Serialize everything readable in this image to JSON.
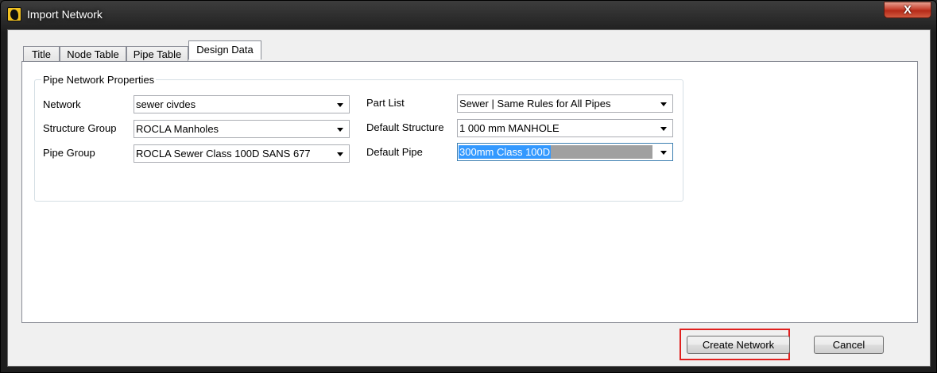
{
  "window": {
    "title": "Import Network",
    "close_glyph": "X"
  },
  "tabs": [
    {
      "label": "Title",
      "active": false
    },
    {
      "label": "Node Table",
      "active": false
    },
    {
      "label": "Pipe Table",
      "active": false
    },
    {
      "label": "Design Data",
      "active": true
    }
  ],
  "group": {
    "title": "Pipe Network Properties",
    "left_fields": [
      {
        "label": "Network",
        "value": "sewer civdes"
      },
      {
        "label": "Structure Group",
        "value": "ROCLA Manholes"
      },
      {
        "label": "Pipe Group",
        "value": "ROCLA Sewer Class 100D SANS 677"
      }
    ],
    "right_fields": [
      {
        "label": "Part List",
        "value": "Sewer | Same Rules for All Pipes"
      },
      {
        "label": "Default Structure",
        "value": "1 000 mm MANHOLE"
      },
      {
        "label": "Default Pipe",
        "value": "300mm Class 100D"
      }
    ]
  },
  "buttons": {
    "create_network": "Create Network",
    "cancel": "Cancel"
  },
  "colors": {
    "highlight": "#e0201e",
    "selection": "#3399ff"
  }
}
